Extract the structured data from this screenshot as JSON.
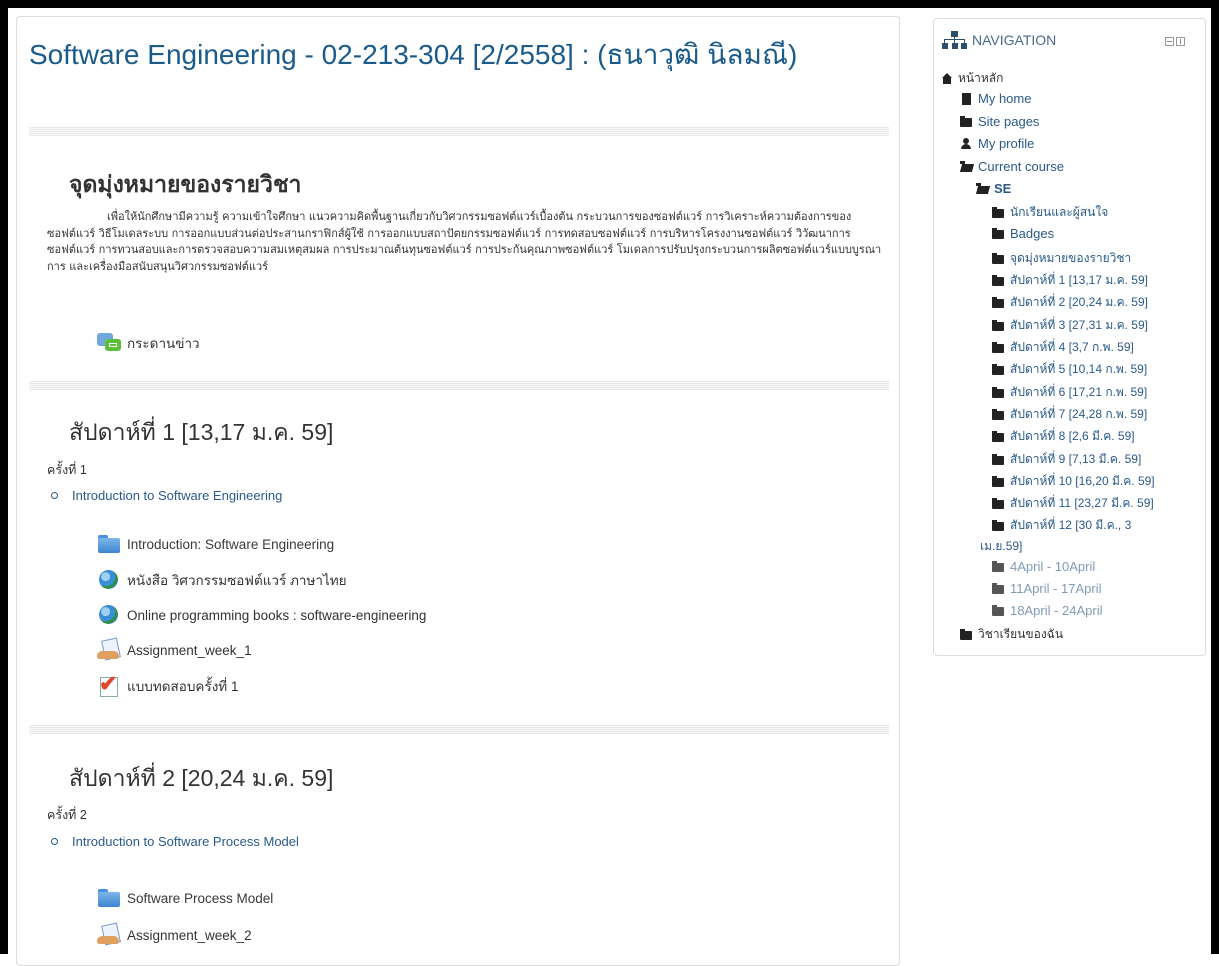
{
  "course": {
    "title": "Software Engineering - 02-213-304 [2/2558] : (ธนาวุฒิ นิลมณี)"
  },
  "sections": [
    {
      "title": "จุดมุ่งหมายของรายวิชา",
      "summary": "เพื่อให้นักศึกษามีความรู้ ความเข้าใจศึกษา แนวความคิดพื้นฐานเกี่ยวกับวิศวกรรมซอฟต์แวร์เบื้องต้น กระบวนการของซอฟต์แวร์ การวิเคราะห์ความต้องการของซอฟต์แวร์ วิธีโมเดลระบบ การออกแบบส่วนต่อประสานกราฟิกส์ผู้ใช้ การออกแบบสถาปัตยกรรมซอฟต์แวร์ การทดสอบซอฟต์แวร์ การบริหารโครงงานซอฟต์แวร์ วิวัฒนาการซอฟต์แวร์ การทวนสอบและการตรวจสอบความสมเหตุสมผล การประมาณต้นทุนซอฟต์แวร์ การประกันคุณภาพซอฟต์แวร์ โมเดลการปรับปรุงกระบวนการผลิตซอฟต์แวร์แบบบูรณาการ และเครื่องมือสนับสนุนวิศวกรรมซอฟต์แวร์",
      "activities": [
        {
          "label": "กระดานข่าว",
          "icon": "forum-icon"
        }
      ]
    },
    {
      "title": "สัปดาห์ที่ 1 [13,17 ม.ค. 59]",
      "session": "ครั้งที่ 1",
      "topic": "Introduction to Software Engineering",
      "activities": [
        {
          "label": "Introduction: Software Engineering",
          "icon": "folder-icon"
        },
        {
          "label": "หนังสือ วิศวกรรมซอฟต์แวร์ ภาษาไทย",
          "icon": "url-globe-icon"
        },
        {
          "label": "Online programming books : software-engineering",
          "icon": "url-globe-icon"
        },
        {
          "label": "Assignment_week_1",
          "icon": "assignment-icon"
        },
        {
          "label": "แบบทดสอบครั้งที่ 1",
          "icon": "quiz-icon"
        }
      ]
    },
    {
      "title": "สัปดาห์ที่ 2 [20,24 ม.ค. 59]",
      "session": "ครั้งที่ 2",
      "topic": "Introduction to Software Process Model",
      "activities": [
        {
          "label": "Software Process Model",
          "icon": "folder-icon"
        },
        {
          "label": "Assignment_week_2",
          "icon": "assignment-icon"
        }
      ]
    }
  ],
  "navigation": {
    "title": "NAVIGATION",
    "home": "หน้าหลัก",
    "my_home": "My home",
    "site_pages": "Site pages",
    "my_profile": "My profile",
    "current_course": "Current course",
    "course_short": "SE",
    "course_items": [
      "นักเรียนและผู้สนใจ",
      "Badges",
      "จุดมุ่งหมายของรายวิชา",
      "สัปดาห์ที่ 1 [13,17 ม.ค. 59]",
      "สัปดาห์ที่ 2 [20,24 ม.ค. 59]",
      "สัปดาห์ที่ 3 [27,31 ม.ค. 59]",
      "สัปดาห์ที่ 4 [3,7 ก.พ. 59]",
      "สัปดาห์ที่ 5 [10,14 ก.พ. 59]",
      "สัปดาห์ที่ 6 [17,21 ก.พ. 59]",
      "สัปดาห์ที่ 7 [24,28 ก.พ. 59]",
      "สัปดาห์ที่ 8 [2,6 มี.ค. 59]",
      "สัปดาห์ที่ 9 [7,13 มี.ค. 59]",
      "สัปดาห์ที่ 10 [16,20 มี.ค. 59]",
      "สัปดาห์ที่ 11 [23,27 มี.ค. 59]",
      "สัปดาห์ที่ 12 [30 มี.ค., 3",
      "เม.ย.59]"
    ],
    "hidden_items": [
      "4April - 10April",
      "11April - 17April",
      "18April - 24April"
    ],
    "my_courses": "วิชาเรียนของฉัน"
  },
  "colors": {
    "title": "#1a5b8c",
    "link": "#2a5a8a",
    "dimmed_link": "#7f9bb8"
  }
}
